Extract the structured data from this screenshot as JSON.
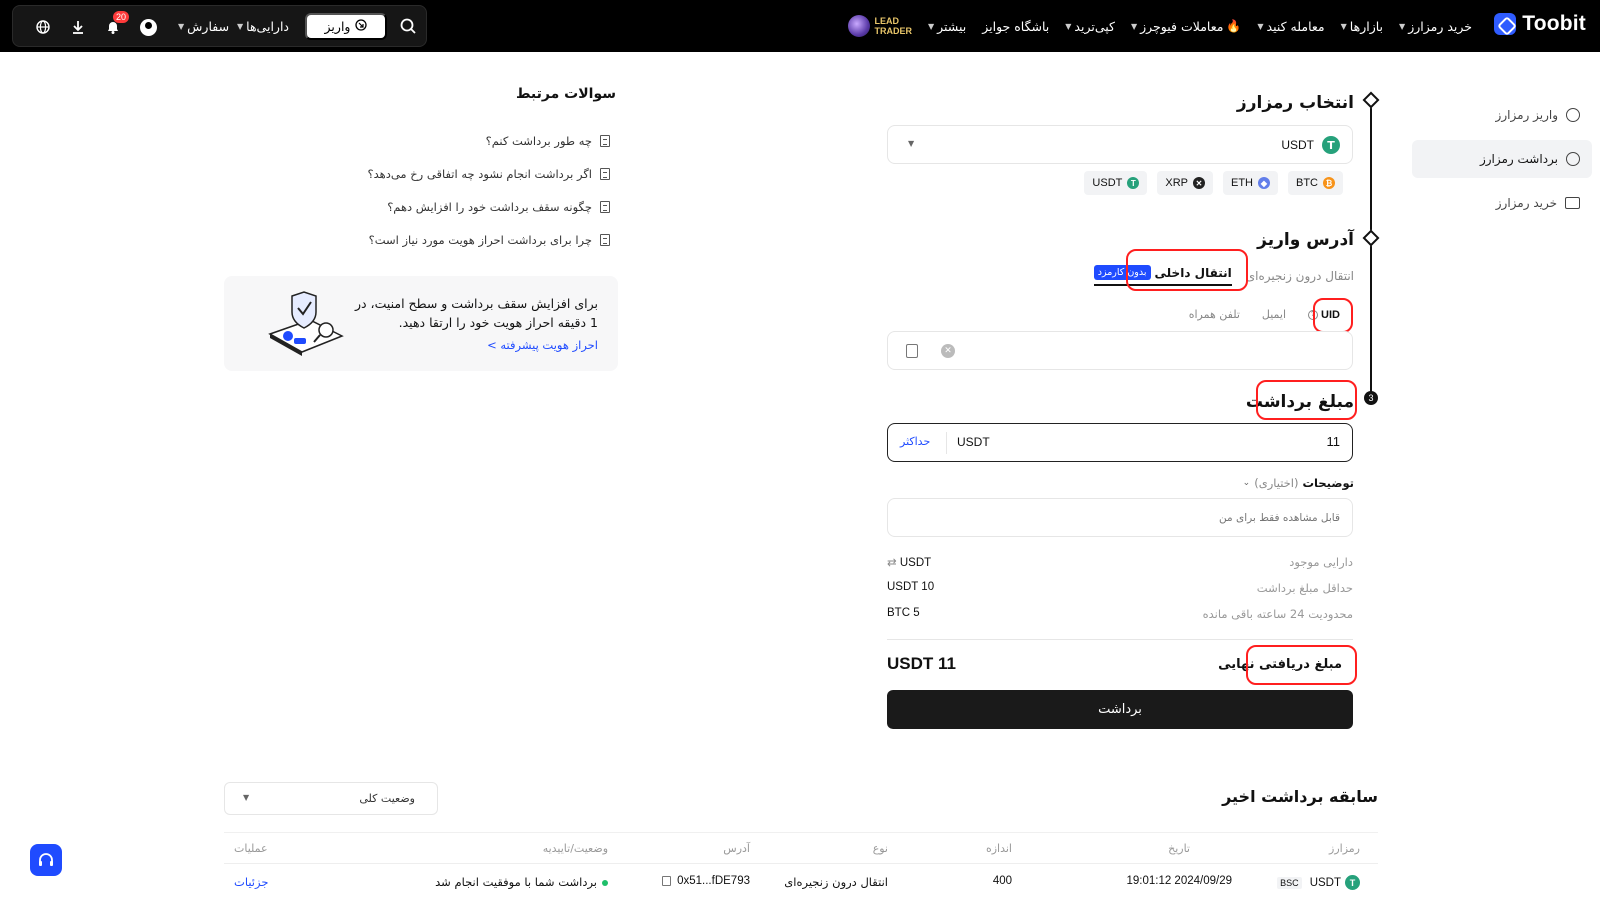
{
  "nav": {
    "brand": "Toobit",
    "menu": [
      {
        "label": "خرید رمزارز",
        "caret": true
      },
      {
        "label": "بازارها",
        "caret": true
      },
      {
        "label": "معامله کنید",
        "caret": true
      },
      {
        "label": "معاملات فیوچرز",
        "caret": true,
        "fire": true
      },
      {
        "label": "کپی‌ترید",
        "caret": true
      },
      {
        "label": "باشگاه جوایز",
        "caret": false
      },
      {
        "label": "بیشتر",
        "caret": true
      }
    ],
    "lead_trader_line1": "LEAD",
    "lead_trader_line2": "TRADER",
    "deposit_label": "واریز",
    "assets_label": "دارایی‌ها",
    "orders_label": "سفارش",
    "notif_count": "20"
  },
  "sidebar": {
    "items": [
      {
        "label": "واریز رمزارز",
        "active": false
      },
      {
        "label": "برداشت رمزارز",
        "active": true
      },
      {
        "label": "خرید رمزارز",
        "active": false
      }
    ]
  },
  "form": {
    "step1_title": "انتخاب رمزارز",
    "selected_coin": "USDT",
    "quick_coins": [
      "BTC",
      "ETH",
      "XRP",
      "USDT"
    ],
    "step2_title": "آدرس واریز",
    "tab_onchain": "انتقال درون زنجیره‌ای",
    "tab_internal": "انتقال داخلی",
    "free_badge": "بدون کارمزد",
    "subtab_uid": "UID",
    "subtab_email": "ایمیل",
    "subtab_phone": "تلفن همراه",
    "address_value": "",
    "step3_num": "3",
    "step3_title": "مبلغ برداشت",
    "amount_value": "11",
    "amount_unit": "USDT",
    "max_label": "حداکثر",
    "notes_label": "توضیحات",
    "notes_optional": "(اختیاری)",
    "notes_placeholder": "قابل مشاهده فقط برای من",
    "available_label": "دارایی موجود",
    "available_value": "USDT",
    "min_label": "حداقل مبلغ برداشت",
    "min_value": "USDT 10",
    "limit_label": "محدودیت 24 ساعته باقی مانده",
    "limit_value": "BTC 5",
    "final_label": "مبلغ دریافتی نهایی",
    "final_value": "USDT 11",
    "submit_label": "برداشت"
  },
  "faq": {
    "title": "سوالات مرتبط",
    "items": [
      "چه طور برداشت کنم؟",
      "اگر برداشت انجام نشود چه اتفاقی رخ می‌دهد؟",
      "چگونه سقف برداشت خود را افزایش دهم؟",
      "چرا برای برداشت احراز هویت مورد نیاز است؟"
    ]
  },
  "kyc": {
    "text": "برای افزایش سقف برداشت و سطح امنیت، در 1 دقیقه احراز هویت خود را ارتقا دهید.",
    "link": "احراز هویت پیشرفته >"
  },
  "history": {
    "title": "سابقه برداشت اخیر",
    "status_filter": "وضعیت کلی",
    "columns": [
      "رمزارز",
      "تاریخ",
      "اندازه",
      "نوع",
      "آدرس",
      "وضعیت/تاییدیه",
      "عملیات"
    ],
    "rows": [
      {
        "coin": "USDT",
        "network": "BSC",
        "date": "19:01:12 2024/09/29",
        "amount": "400",
        "type": "انتقال درون زنجیره‌ای",
        "address": "0x51...fDE793",
        "status": "برداشت شما با موفقیت انجام شد",
        "action": "جزئیات"
      }
    ]
  },
  "colors": {
    "accent": "#1f4bff",
    "highlight": "#ff1f1f",
    "success": "#1fbf6a"
  }
}
